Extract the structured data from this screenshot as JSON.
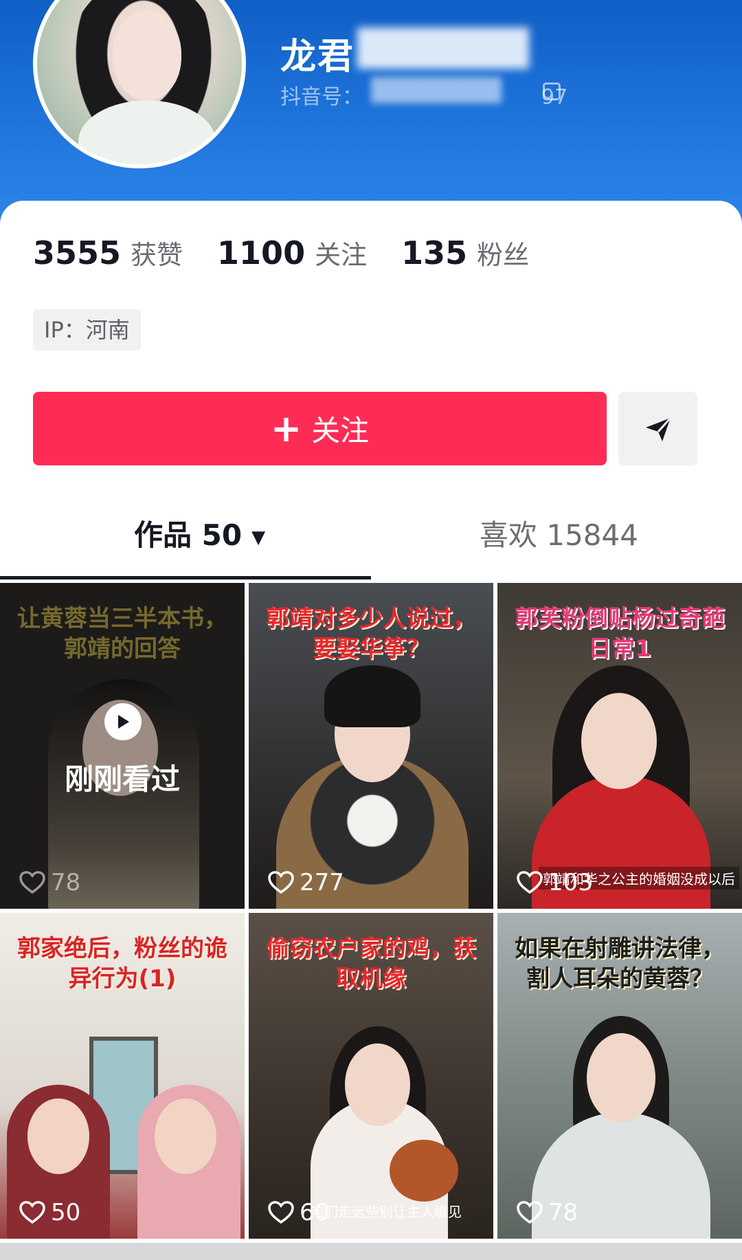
{
  "profile": {
    "nickname": "龙君",
    "douyin_id_label": "抖音号：",
    "douyin_id_suffix": "97"
  },
  "stats": [
    {
      "value": "3555",
      "label": "获赞"
    },
    {
      "value": "1100",
      "label": "关注"
    },
    {
      "value": "135",
      "label": "粉丝"
    }
  ],
  "ip": "IP：河南",
  "follow_button": {
    "label": "关注",
    "plus": "+"
  },
  "tabs": {
    "works_label": "作品 50",
    "likes_label": "喜欢 15844"
  },
  "videos": [
    {
      "caption": "让黄蓉当三半本书，郭靖的回答",
      "likes": "78",
      "watched_label": "刚刚看过"
    },
    {
      "caption": "郭靖对多少人说过，要娶华筝？",
      "likes": "277"
    },
    {
      "caption": "郭芙粉倒贴杨过奇葩日常1",
      "likes": "103",
      "subtitle": "郭靖和华之公主的婚姻没成以后"
    },
    {
      "caption": "郭家绝后，粉丝的诡异行为(1)",
      "likes": "50"
    },
    {
      "caption": "偷窃农户家的鸡，获取机缘",
      "likes": "60",
      "subtitle": "咱们走远些别让主人瞧见"
    },
    {
      "caption": "如果在射雕讲法律，割人耳朵的黄蓉？",
      "likes": "78"
    }
  ],
  "icons": {
    "share": "paper-plane-icon",
    "copy": "copy-icon",
    "like": "heart-icon",
    "play": "play-icon"
  },
  "colors": {
    "header_blue": "#1f75dc",
    "follow_red": "#fe2c55",
    "text_dark": "#161823"
  }
}
